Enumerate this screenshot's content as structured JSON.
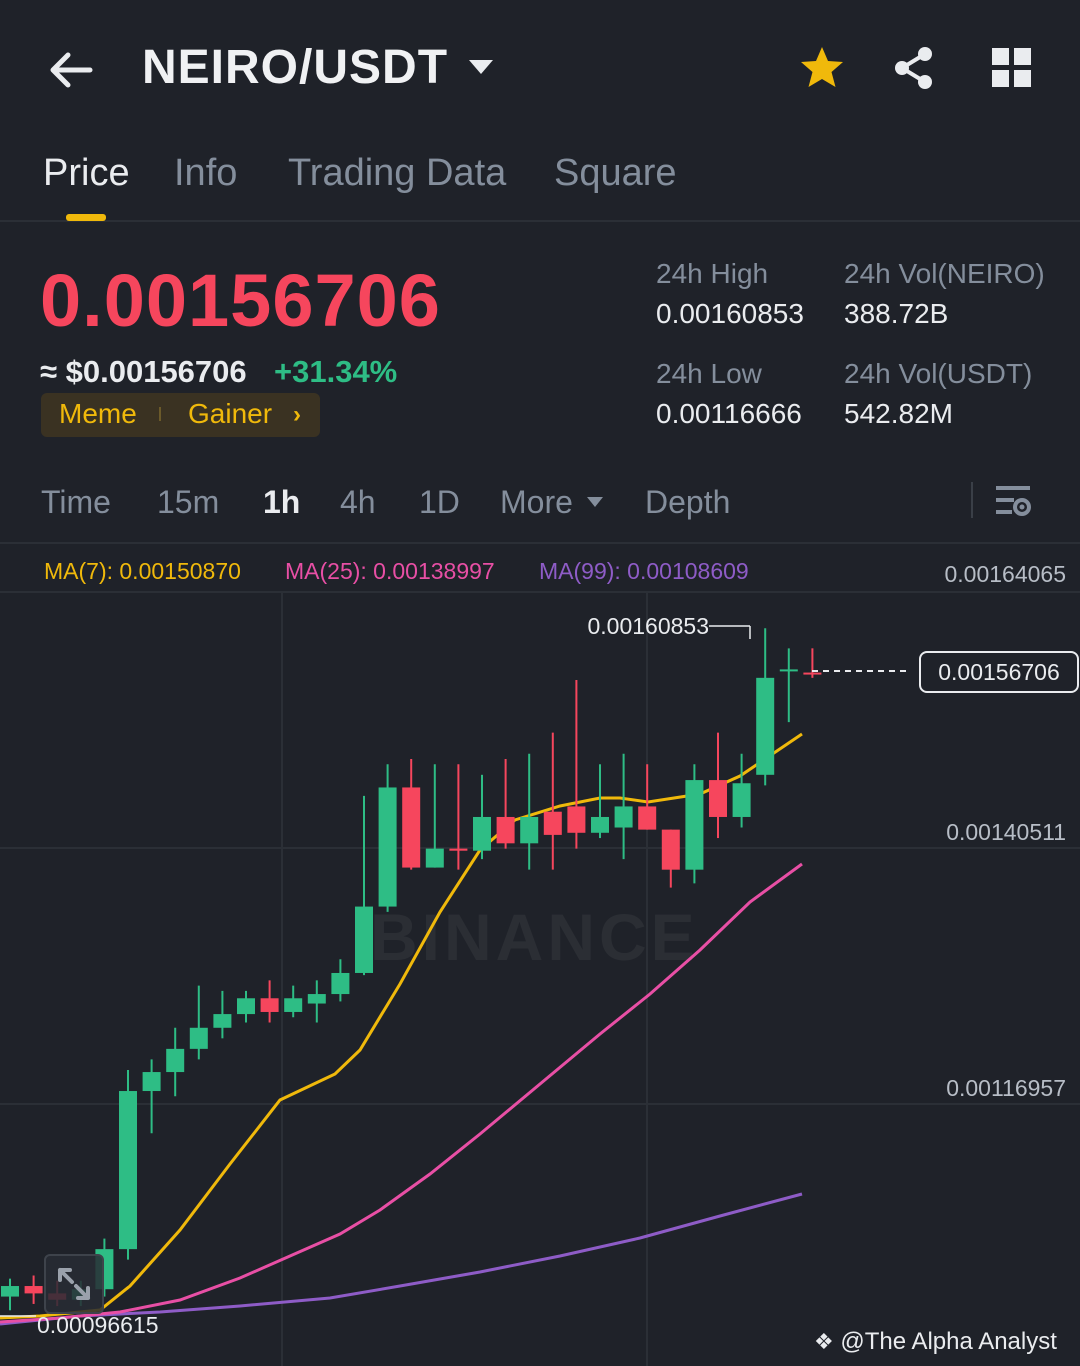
{
  "header": {
    "pair": "NEIRO/USDT",
    "icons": [
      "back-arrow-icon",
      "caret-down-icon",
      "star-icon",
      "share-icon",
      "grid-icon"
    ],
    "star_color": "#f0b90b"
  },
  "tabs": [
    {
      "label": "Price",
      "active": true
    },
    {
      "label": "Info"
    },
    {
      "label": "Trading Data"
    },
    {
      "label": "Square"
    }
  ],
  "price": {
    "last": "0.00156706",
    "approx": "≈ $0.00156706",
    "change": "+31.34%",
    "tags": [
      "Meme",
      "Gainer"
    ],
    "color_down": "#f6465d",
    "color_up": "#2ebd85"
  },
  "stats": {
    "high_label": "24h High",
    "high_value": "0.00160853",
    "low_label": "24h Low",
    "low_value": "0.00116666",
    "vol_base_label": "24h Vol(NEIRO)",
    "vol_base_value": "388.72B",
    "vol_quote_label": "24h Vol(USDT)",
    "vol_quote_value": "542.82M"
  },
  "intervals": [
    {
      "label": "Time"
    },
    {
      "label": "15m"
    },
    {
      "label": "1h",
      "active": true
    },
    {
      "label": "4h"
    },
    {
      "label": "1D"
    },
    {
      "label": "More"
    },
    {
      "label": "Depth"
    }
  ],
  "chart": {
    "ma7": "MA(7): 0.00150870",
    "ma25": "MA(25): 0.00138997",
    "ma99": "MA(99): 0.00108609",
    "ma7_color": "#f0b90b",
    "ma25_color": "#e84fa5",
    "ma99_color": "#8e5cc7",
    "axis": [
      "0.00164065",
      "0.00140511",
      "0.00116957"
    ],
    "bottom_label": "0.00096615",
    "high_label": "0.00160853",
    "current_label": "0.00156706",
    "watermark": "BINANCE",
    "credit": "@The Alpha Analyst"
  },
  "chart_data": {
    "type": "candlestick",
    "y_ticks": [
      0.00164065,
      0.00140511,
      0.00116957
    ],
    "ylim": [
      0.00093,
      0.00167
    ],
    "current_price": 0.00156706,
    "marked_high": 0.00160853,
    "marked_low": 0.00096615,
    "candles": [
      {
        "o": 0.000975,
        "h": 0.000992,
        "l": 0.000962,
        "c": 0.000985
      },
      {
        "o": 0.000985,
        "h": 0.000995,
        "l": 0.000968,
        "c": 0.000978
      },
      {
        "o": 0.000978,
        "h": 0.00099,
        "l": 0.000966,
        "c": 0.000972
      },
      {
        "o": 0.000972,
        "h": 0.00099,
        "l": 0.000966,
        "c": 0.000982
      },
      {
        "o": 0.000982,
        "h": 0.00103,
        "l": 0.000975,
        "c": 0.00102
      },
      {
        "o": 0.00102,
        "h": 0.00119,
        "l": 0.00101,
        "c": 0.00117
      },
      {
        "o": 0.00117,
        "h": 0.0012,
        "l": 0.00113,
        "c": 0.001188
      },
      {
        "o": 0.001188,
        "h": 0.00123,
        "l": 0.001165,
        "c": 0.00121
      },
      {
        "o": 0.00121,
        "h": 0.00127,
        "l": 0.0012,
        "c": 0.00123
      },
      {
        "o": 0.00123,
        "h": 0.001265,
        "l": 0.00122,
        "c": 0.001243
      },
      {
        "o": 0.001243,
        "h": 0.001265,
        "l": 0.001235,
        "c": 0.001258
      },
      {
        "o": 0.001258,
        "h": 0.001275,
        "l": 0.001235,
        "c": 0.001245
      },
      {
        "o": 0.001245,
        "h": 0.00127,
        "l": 0.00124,
        "c": 0.001258
      },
      {
        "o": 0.001253,
        "h": 0.001275,
        "l": 0.001235,
        "c": 0.001262
      },
      {
        "o": 0.001262,
        "h": 0.001295,
        "l": 0.001255,
        "c": 0.001282
      },
      {
        "o": 0.001282,
        "h": 0.00145,
        "l": 0.00128,
        "c": 0.001345
      },
      {
        "o": 0.001345,
        "h": 0.00148,
        "l": 0.00134,
        "c": 0.001458
      },
      {
        "o": 0.001458,
        "h": 0.001485,
        "l": 0.00138,
        "c": 0.001382
      },
      {
        "o": 0.001382,
        "h": 0.00148,
        "l": 0.001385,
        "c": 0.0014
      },
      {
        "o": 0.0014,
        "h": 0.00148,
        "l": 0.00138,
        "c": 0.001398
      },
      {
        "o": 0.001398,
        "h": 0.00147,
        "l": 0.00139,
        "c": 0.00143
      },
      {
        "o": 0.00143,
        "h": 0.001485,
        "l": 0.0014,
        "c": 0.001405
      },
      {
        "o": 0.001405,
        "h": 0.00149,
        "l": 0.00138,
        "c": 0.00143
      },
      {
        "o": 0.001435,
        "h": 0.00151,
        "l": 0.00138,
        "c": 0.001413
      },
      {
        "o": 0.00144,
        "h": 0.00156,
        "l": 0.0014,
        "c": 0.001415
      },
      {
        "o": 0.001415,
        "h": 0.00148,
        "l": 0.00141,
        "c": 0.00143
      },
      {
        "o": 0.00142,
        "h": 0.00149,
        "l": 0.00139,
        "c": 0.00144
      },
      {
        "o": 0.00144,
        "h": 0.00148,
        "l": 0.00142,
        "c": 0.001418
      },
      {
        "o": 0.001418,
        "h": 0.00141,
        "l": 0.001363,
        "c": 0.00138
      },
      {
        "o": 0.00138,
        "h": 0.00148,
        "l": 0.001367,
        "c": 0.001465
      },
      {
        "o": 0.001465,
        "h": 0.00151,
        "l": 0.00141,
        "c": 0.00143
      },
      {
        "o": 0.00143,
        "h": 0.00149,
        "l": 0.00142,
        "c": 0.001462
      },
      {
        "o": 0.00147,
        "h": 0.001609,
        "l": 0.00146,
        "c": 0.001562
      },
      {
        "o": 0.00157,
        "h": 0.00159,
        "l": 0.00152,
        "c": 0.00157
      },
      {
        "o": 0.001567,
        "h": 0.00159,
        "l": 0.001562,
        "c": 0.001566
      }
    ]
  }
}
